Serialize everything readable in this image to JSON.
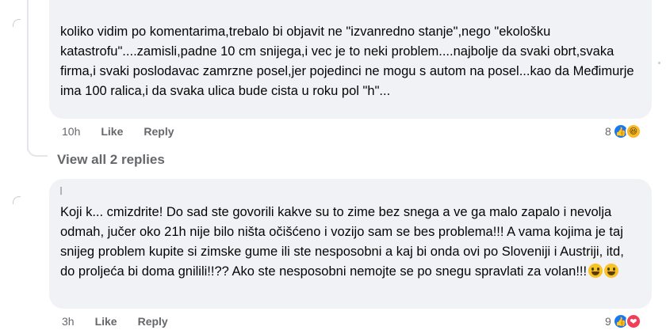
{
  "comments": [
    {
      "text": "koliko vidim po komentarima,trebalo bi objavit ne \"izvanredno stanje\",nego \"ekološku katastrofu\"....zamisli,padne 10 cm snijega,i vec je to neki problem....najbolje da svaki obrt,svaka firma,i svaki poslodavac zamrzne posel,jer pojedinci ne mogu s autom na posel...kao da Međimurje ima 100 ralica,i da svaka ulica bude cista u roku pol \"h\"...",
      "time": "10h",
      "like_label": "Like",
      "reply_label": "Reply",
      "reaction_count": "8",
      "reactions": [
        "like-icon",
        "haha-icon"
      ]
    },
    {
      "text": "Koji k... cmizdrite! Do sad ste govorili kakve su to zime bez snega a ve ga malo zapalo i nevolja odmah, jučer oko 21h nije bilo ništa očišćeno i vozijo sam se bes problema!!! A vama kojima je taj snijeg problem kupite si zimske gume ili ste nesposobni a kaj bi onda ovi po Sloveniji i Austriji, itd, do proljeća bi doma gnilili!!?? Ako ste nesposobni nemojte se po snegu spravlati za volan!!!",
      "time": "3h",
      "like_label": "Like",
      "reply_label": "Reply",
      "reaction_count": "9",
      "reactions": [
        "like-icon",
        "love-icon"
      ]
    }
  ],
  "view_replies_label": "View all 2 replies"
}
